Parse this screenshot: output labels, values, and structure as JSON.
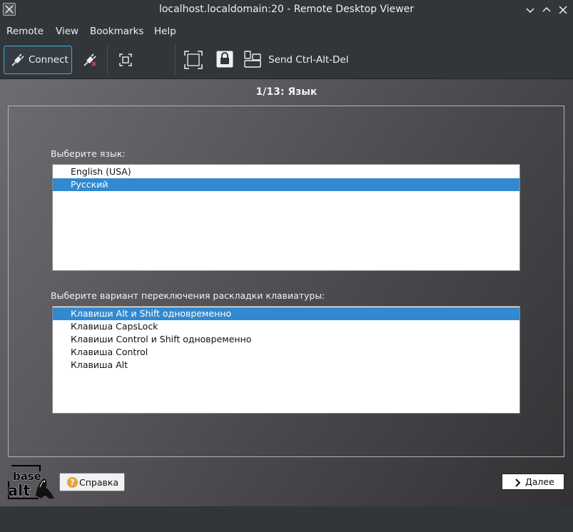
{
  "window": {
    "title": "localhost.localdomain:20 - Remote Desktop Viewer"
  },
  "menu": {
    "items": [
      "Remote",
      "View",
      "Bookmarks",
      "Help"
    ]
  },
  "toolbar": {
    "connect_label": "Connect",
    "send_keys_label": "Send Ctrl-Alt-Del"
  },
  "installer": {
    "step_title": "1/13: Язык",
    "language_label": "Выберите язык:",
    "languages": [
      "English (USA)",
      "Русский"
    ],
    "selected_language": "Русский",
    "layout_label": "Выберите вариант переключения раскладки клавиатуры:",
    "layout_options": [
      "Клавиши Alt и Shift одновременно",
      "Клавиша CapsLock",
      "Клавиши Control и Shift одновременно",
      "Клавиша Control",
      "Клавиша Alt"
    ],
    "selected_layout": "Клавиши Alt и Shift одновременно",
    "help_button": "Справка",
    "next_button": "Далее",
    "logo_text": [
      "base",
      "alt"
    ]
  },
  "colors": {
    "accent": "#3daee9",
    "selection": "#3289cf",
    "chrome_bg": "#31363b"
  }
}
